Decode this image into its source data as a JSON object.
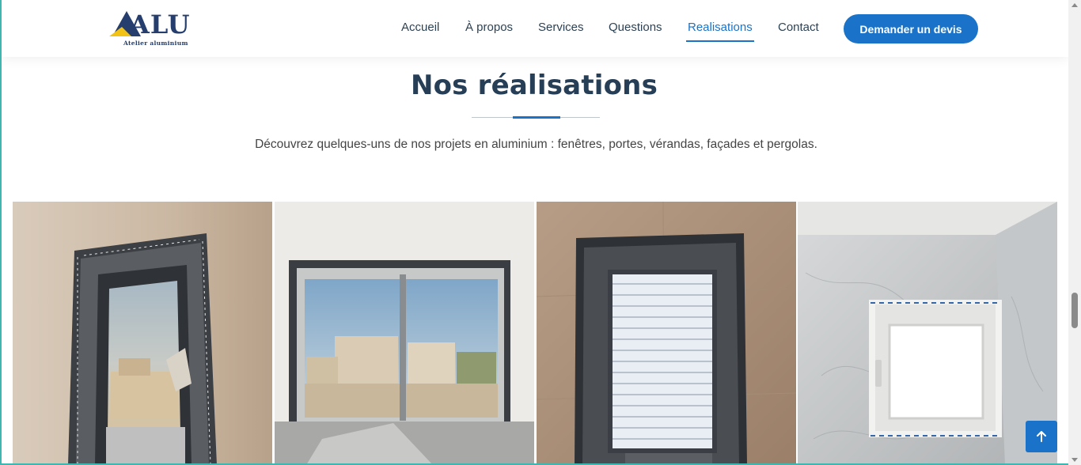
{
  "brand": {
    "name": "ALU",
    "tagline": "Atelier aluminium",
    "accent": "#1a73c8",
    "logo_triangle_color": "#f2c314"
  },
  "nav": {
    "items": [
      {
        "label": "Accueil",
        "active": false
      },
      {
        "label": "À propos",
        "active": false
      },
      {
        "label": "Services",
        "active": false
      },
      {
        "label": "Questions",
        "active": false
      },
      {
        "label": "Realisations",
        "active": true
      },
      {
        "label": "Contact",
        "active": false
      }
    ],
    "cta_label": "Demander un devis"
  },
  "section": {
    "title": "Nos réalisations",
    "subtitle": "Découvrez quelques-uns de nos projets en aluminium : fenêtres, portes, vérandas, façades et pergolas."
  },
  "gallery": {
    "photos": [
      {
        "subject": "aluminium window with protective film, view of rooftops"
      },
      {
        "subject": "sliding glass door overlooking buildings"
      },
      {
        "subject": "window with roller shutter in tiled wall"
      },
      {
        "subject": "white PVC window in marble bathroom"
      }
    ]
  },
  "icons": {
    "back_to_top": "arrow-up-icon"
  }
}
